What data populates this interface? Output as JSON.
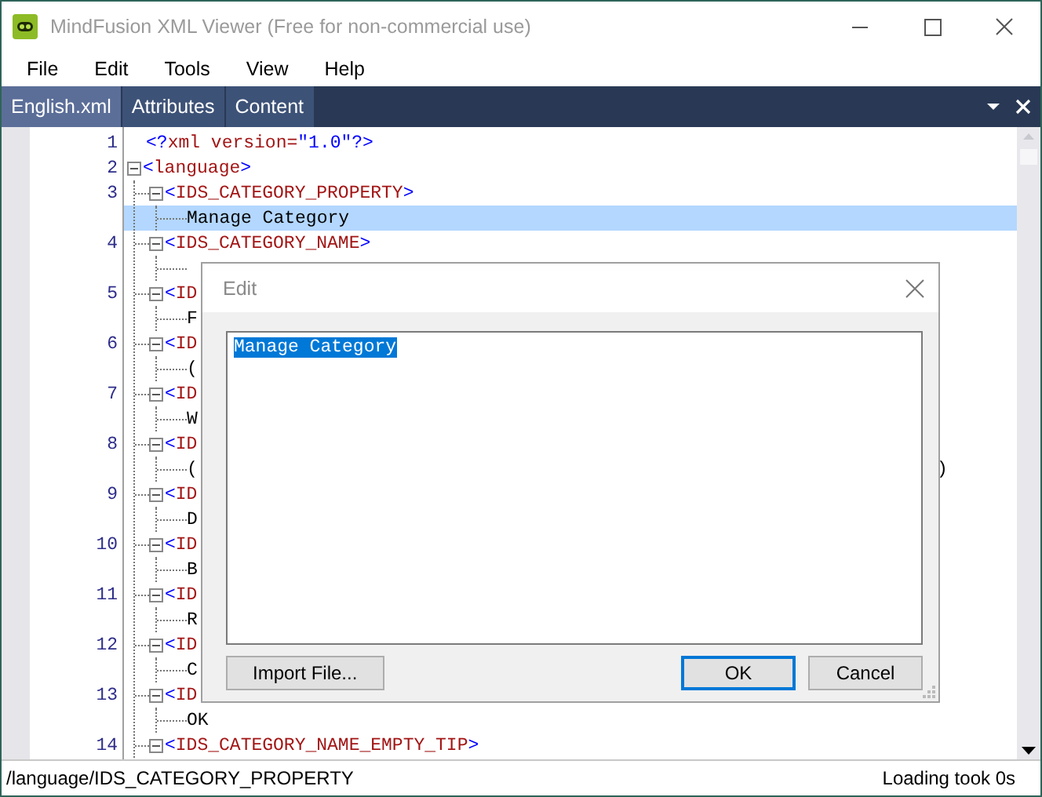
{
  "window": {
    "title": "MindFusion XML Viewer (Free for non-commercial use)"
  },
  "menu": [
    "File",
    "Edit",
    "Tools",
    "View",
    "Help"
  ],
  "tabs": [
    {
      "label": "English.xml",
      "selected": true
    },
    {
      "label": "Attributes",
      "selected": false
    },
    {
      "label": "Content",
      "selected": false
    }
  ],
  "editor": {
    "nodes": [
      {
        "kind": "decl",
        "number": "1",
        "segments": [
          {
            "text": "<?",
            "kind": "bracket"
          },
          {
            "text": "xml version=",
            "kind": "name"
          },
          {
            "text": "\"1.0\"",
            "kind": "bracket"
          },
          {
            "text": "?>",
            "kind": "bracket"
          }
        ]
      },
      {
        "kind": "tag",
        "number": "2",
        "expanded": true,
        "segments": [
          {
            "text": "<",
            "kind": "bracket"
          },
          {
            "text": "language",
            "kind": "name"
          },
          {
            "text": ">",
            "kind": "bracket"
          }
        ],
        "children": [
          {
            "kind": "tag",
            "number": "3",
            "expanded": true,
            "segments": [
              {
                "text": "<",
                "kind": "bracket"
              },
              {
                "text": "IDS_CATEGORY_PROPERTY",
                "kind": "name"
              },
              {
                "text": ">",
                "kind": "bracket"
              }
            ],
            "children": [
              {
                "kind": "text",
                "text": "Manage Category",
                "selected": true
              }
            ]
          },
          {
            "kind": "tag",
            "number": "4",
            "expanded": true,
            "segments": [
              {
                "text": "<",
                "kind": "bracket"
              },
              {
                "text": "IDS_CATEGORY_NAME",
                "kind": "name"
              },
              {
                "text": ">",
                "kind": "bracket"
              }
            ],
            "children": [
              {
                "kind": "text",
                "selected": false
              }
            ]
          },
          {
            "kind": "tag",
            "number": "5",
            "expanded": true,
            "segments": [
              {
                "text": "<",
                "kind": "bracket"
              },
              {
                "text": "ID",
                "kind": "name"
              }
            ],
            "children": [
              {
                "kind": "text",
                "text": "F",
                "selected": false
              }
            ]
          },
          {
            "kind": "tag",
            "number": "6",
            "expanded": true,
            "segments": [
              {
                "text": "<",
                "kind": "bracket"
              },
              {
                "text": "ID",
                "kind": "name"
              }
            ],
            "children": [
              {
                "kind": "text",
                "text": "(",
                "selected": false
              }
            ]
          },
          {
            "kind": "tag",
            "number": "7",
            "expanded": true,
            "segments": [
              {
                "text": "<",
                "kind": "bracket"
              },
              {
                "text": "ID",
                "kind": "name"
              }
            ],
            "children": [
              {
                "kind": "text",
                "text": "W",
                "selected": false
              }
            ]
          },
          {
            "kind": "tag",
            "number": "8",
            "expanded": true,
            "segments": [
              {
                "text": "<",
                "kind": "bracket"
              },
              {
                "text": "ID",
                "kind": "name"
              }
            ],
            "children": [
              {
                "kind": "text",
                "text": "(",
                "tail": ")",
                "selected": false
              }
            ]
          },
          {
            "kind": "tag",
            "number": "9",
            "expanded": true,
            "segments": [
              {
                "text": "<",
                "kind": "bracket"
              },
              {
                "text": "ID",
                "kind": "name"
              }
            ],
            "children": [
              {
                "kind": "text",
                "text": "D",
                "selected": false
              }
            ]
          },
          {
            "kind": "tag",
            "number": "10",
            "expanded": true,
            "segments": [
              {
                "text": "<",
                "kind": "bracket"
              },
              {
                "text": "ID",
                "kind": "name"
              }
            ],
            "children": [
              {
                "kind": "text",
                "text": "B",
                "selected": false
              }
            ]
          },
          {
            "kind": "tag",
            "number": "11",
            "expanded": true,
            "segments": [
              {
                "text": "<",
                "kind": "bracket"
              },
              {
                "text": "ID",
                "kind": "name"
              }
            ],
            "children": [
              {
                "kind": "text",
                "text": "R",
                "selected": false
              }
            ]
          },
          {
            "kind": "tag",
            "number": "12",
            "expanded": true,
            "segments": [
              {
                "text": "<",
                "kind": "bracket"
              },
              {
                "text": "ID",
                "kind": "name"
              }
            ],
            "children": [
              {
                "kind": "text",
                "text": "C",
                "selected": false
              }
            ]
          },
          {
            "kind": "tag",
            "number": "13",
            "expanded": true,
            "segments": [
              {
                "text": "<",
                "kind": "bracket"
              },
              {
                "text": "ID",
                "kind": "name"
              }
            ],
            "children": [
              {
                "kind": "text",
                "text": "OK",
                "selected": false
              }
            ]
          },
          {
            "kind": "tag",
            "number": "14",
            "expanded": true,
            "segments": [
              {
                "text": "<",
                "kind": "bracket"
              },
              {
                "text": "IDS_CATEGORY_NAME_EMPTY_TIP",
                "kind": "name"
              },
              {
                "text": ">",
                "kind": "bracket"
              }
            ]
          }
        ]
      }
    ]
  },
  "dialog": {
    "title": "Edit",
    "value": "Manage Category",
    "buttons": [
      {
        "label": "Import File...",
        "kind": "side",
        "default": false
      },
      {
        "label": "OK",
        "kind": "main",
        "default": true
      },
      {
        "label": "Cancel",
        "kind": "main",
        "default": false
      }
    ]
  },
  "status_bar": {
    "path": "/language/IDS_CATEGORY_PROPERTY",
    "message": "Loading took 0s"
  }
}
